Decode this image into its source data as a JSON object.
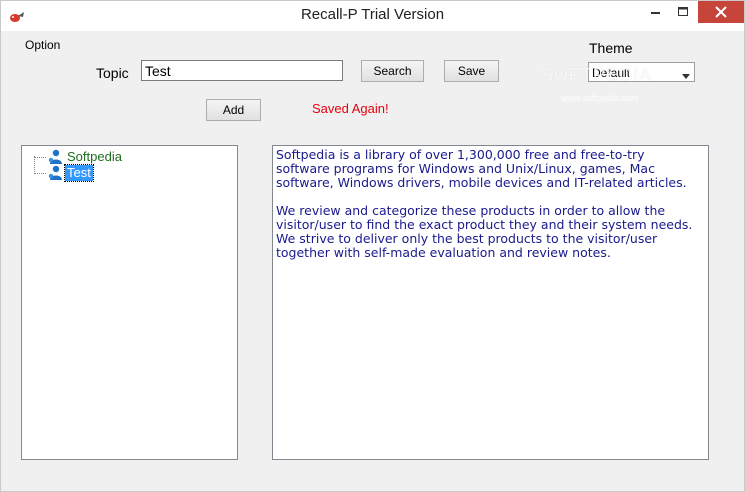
{
  "window": {
    "title": "Recall-P Trial Version",
    "controls": {
      "minimize": "minimize-icon",
      "maximize": "maximize-icon",
      "close": "close-icon"
    }
  },
  "menu": {
    "option": "Option"
  },
  "form": {
    "topic_label": "Topic",
    "topic_value": "Test",
    "search_label": "Search",
    "save_label": "Save",
    "add_label": "Add",
    "status_message": "Saved Again!",
    "theme_label": "Theme",
    "theme_value": "Default"
  },
  "watermark": {
    "brand": "SOFTPEDIA",
    "url": "www.softpedia.com"
  },
  "tree": {
    "items": [
      {
        "label": "Softpedia",
        "icon": "user-icon",
        "selected": false
      },
      {
        "label": "Test",
        "icon": "user-icon",
        "selected": true
      }
    ]
  },
  "content": {
    "paragraph_1": "Softpedia is a library of over 1,300,000 free and free-to-try\nsoftware programs for Windows and Unix/Linux, games, Mac\nsoftware, Windows drivers, mobile devices and IT-related articles.",
    "paragraph_2": "We review and categorize these products in order to allow the\nvisitor/user to find the exact product they and their system needs.\nWe strive to deliver only the best products to the visitor/user\ntogether with self-made evaluation and review notes."
  },
  "colors": {
    "status": "#e8000d",
    "content_text": "#1a1a8c",
    "tree_text": "#1f6e1f",
    "selection": "#3399ff",
    "close_button": "#c7443a"
  }
}
